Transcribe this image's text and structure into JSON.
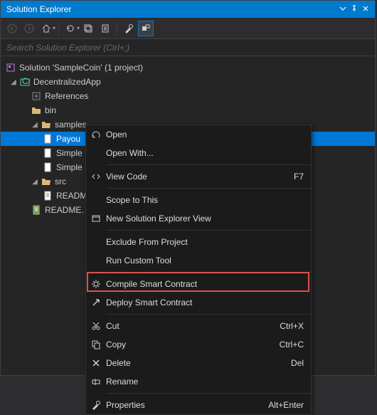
{
  "panel": {
    "title": "Solution Explorer"
  },
  "search": {
    "placeholder": "Search Solution Explorer (Ctrl+;)"
  },
  "tree": {
    "solution": "Solution 'SampleCoin' (1 project)",
    "project": "DecentralizedApp",
    "references": "References",
    "bin": "bin",
    "samples": "samples",
    "payout": "Payou",
    "simple1": "Simple",
    "simple2": "Simple",
    "src": "src",
    "readme1": "README.",
    "readme2": "README."
  },
  "menu": {
    "open": "Open",
    "openWith": "Open With...",
    "viewCode": "View Code",
    "viewCodeKey": "F7",
    "scopeToThis": "Scope to This",
    "newSolutionExplorerView": "New Solution Explorer View",
    "excludeFromProject": "Exclude From Project",
    "runCustomTool": "Run Custom Tool",
    "compileSmartContract": "Compile Smart Contract",
    "deploySmartContract": "Deploy Smart Contract",
    "cut": "Cut",
    "cutKey": "Ctrl+X",
    "copy": "Copy",
    "copyKey": "Ctrl+C",
    "delete": "Delete",
    "deleteKey": "Del",
    "rename": "Rename",
    "properties": "Properties",
    "propertiesKey": "Alt+Enter"
  }
}
